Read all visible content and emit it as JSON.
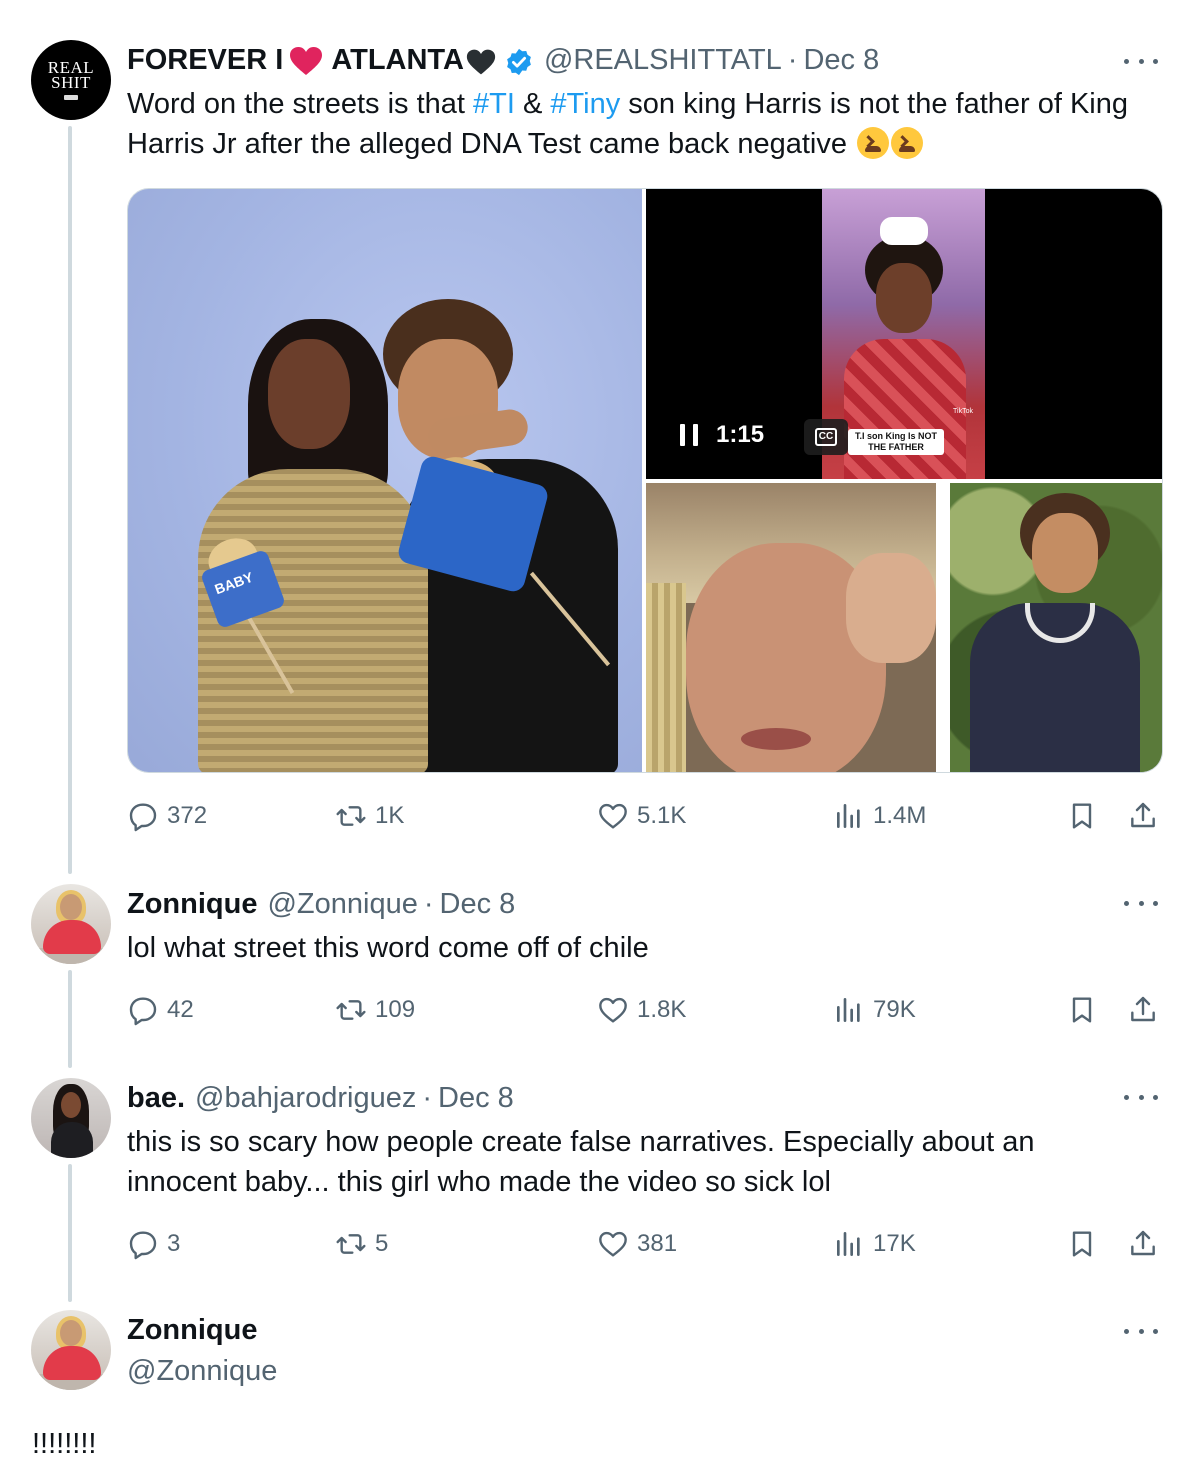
{
  "tweets": [
    {
      "name": "FOREVER I",
      "name_suffix": "ATLANTA",
      "handle": "@REALSHITTATL",
      "date": "Dec 8",
      "avatar_text_1": "REAL",
      "avatar_text_2": "SHIT",
      "text_parts": [
        "Word on the streets is that ",
        "#TI",
        " & ",
        "#Tiny",
        " son king Harris is not the father of King Harris Jr after the alleged DNA Test came back negative"
      ],
      "video": {
        "duration": "1:15",
        "cc_label": "CC",
        "caption_line1": "T.I son King Is NOT",
        "caption_line2": "THE FATHER",
        "tiktok_label": "TikTok"
      },
      "photo_text": "BABY",
      "stats": {
        "replies": "372",
        "retweets": "1K",
        "likes": "5.1K",
        "views": "1.4M"
      }
    },
    {
      "name": "Zonnique",
      "handle": "@Zonnique",
      "date": "Dec 8",
      "text": "lol what street this word come off of chile",
      "stats": {
        "replies": "42",
        "retweets": "109",
        "likes": "1.8K",
        "views": "79K"
      }
    },
    {
      "name": "bae.",
      "handle": "@bahjarodriguez",
      "date": "Dec 8",
      "text": "this is so scary how people create false narratives. Especially about an innocent baby... this girl who made the video so sick lol",
      "stats": {
        "replies": "3",
        "retweets": "5",
        "likes": "381",
        "views": "17K"
      }
    },
    {
      "name": "Zonnique",
      "handle": "@Zonnique",
      "text": "!!!!!!!!"
    }
  ],
  "separator": "·",
  "colors": {
    "link": "#1d9bf0",
    "verified": "#1d9bf0",
    "muted": "#536471",
    "heart": "#e0245e"
  }
}
